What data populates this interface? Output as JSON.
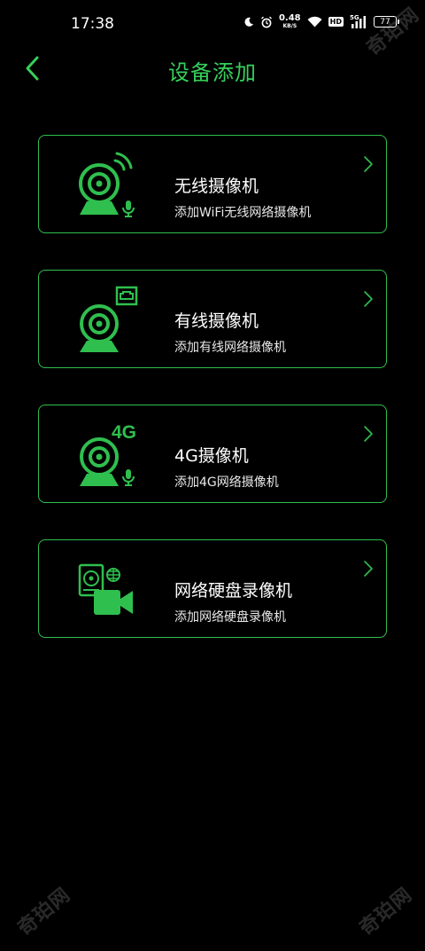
{
  "status_bar": {
    "time": "17:38",
    "net_speed_value": "0.48",
    "net_speed_unit": "KB/S",
    "hd_label": "HD",
    "signal_label": "5G",
    "battery": "77"
  },
  "header": {
    "title": "设备添加"
  },
  "devices": [
    {
      "title": "无线摄像机",
      "subtitle": "添加WiFi无线网络摄像机",
      "icon": "wireless-camera-icon"
    },
    {
      "title": "有线摄像机",
      "subtitle": "添加有线网络摄像机",
      "icon": "wired-camera-icon"
    },
    {
      "title": "4G摄像机",
      "subtitle": "添加4G网络摄像机",
      "icon": "4g-camera-icon",
      "icon_label": "4G"
    },
    {
      "title": "网络硬盘录像机",
      "subtitle": "添加网络硬盘录像机",
      "icon": "nvr-icon"
    }
  ],
  "watermark": "奇珀网",
  "colors": {
    "accent": "#36d05a",
    "border": "#2fbf4e",
    "background": "#000000"
  }
}
